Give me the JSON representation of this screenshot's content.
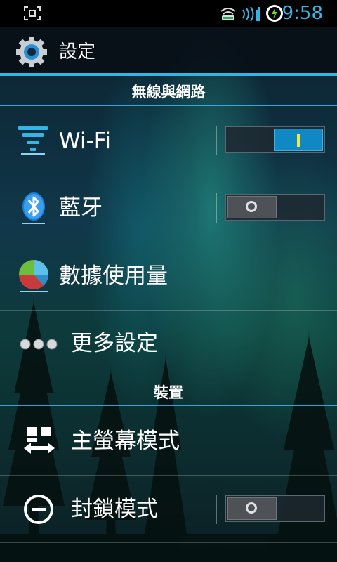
{
  "status_bar": {
    "time": "9:58",
    "icons": [
      "screenshot-icon",
      "wifi-signal-icon",
      "cell-signal-icon",
      "battery-charging-icon"
    ]
  },
  "action_bar": {
    "title": "設定",
    "icon": "settings-gear-icon"
  },
  "sections": {
    "wireless": {
      "header": "無線與網路",
      "wifi": {
        "label": "Wi-Fi",
        "icon": "wifi-icon",
        "toggle_on": true
      },
      "bluetooth": {
        "label": "藍牙",
        "icon": "bluetooth-icon",
        "toggle_on": false
      },
      "data_usage": {
        "label": "數據使用量",
        "icon": "pie-chart-icon"
      },
      "more": {
        "label": "更多設定",
        "icon": "more-dots-icon"
      }
    },
    "device": {
      "header": "裝置",
      "home_mode": {
        "label": "主螢幕模式",
        "icon": "home-mode-icon"
      },
      "block_mode": {
        "label": "封鎖模式",
        "icon": "block-icon",
        "toggle_on": false
      }
    }
  },
  "colors": {
    "accent": "#33b5e5",
    "toggle_on": "#0f88c3",
    "toggle_off": "#4e5257"
  }
}
